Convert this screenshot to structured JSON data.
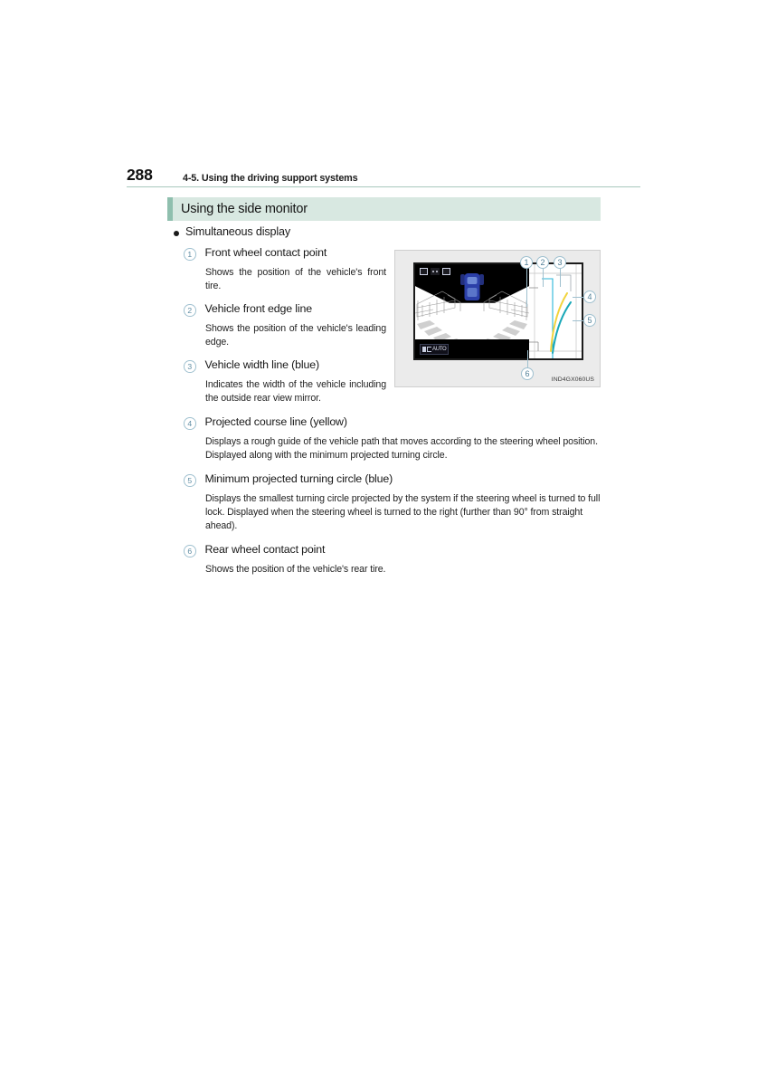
{
  "page": {
    "number": "288",
    "running_head": "4-5. Using the driving support systems"
  },
  "section": {
    "title": "Using the side monitor",
    "accent_color": "#8fbfae",
    "background_color": "#d8e8e1"
  },
  "bullet": {
    "label": "Simultaneous display"
  },
  "items": [
    {
      "num": "1",
      "title": "Front wheel contact point",
      "desc": "Shows the position of the vehicle's front tire.",
      "width": "narrow"
    },
    {
      "num": "2",
      "title": "Vehicle front edge line",
      "desc": "Shows the position of the vehicle's leading edge.",
      "width": "narrow"
    },
    {
      "num": "3",
      "title": "Vehicle width line (blue)",
      "desc": "Indicates the width of the vehicle including the outside rear view mirror.",
      "width": "narrow"
    },
    {
      "num": "4",
      "title": "Projected course line (yellow)",
      "desc": "Displays a rough guide of the vehicle path that moves according to the steering wheel position. Displayed along with the minimum projected turning circle.",
      "width": "wide"
    },
    {
      "num": "5",
      "title": "Minimum projected turning circle (blue)",
      "desc": "Displays the smallest turning circle projected by the system if the steering wheel is turned to full lock. Displayed when the steering wheel is turned to the right (further than 90° from straight ahead).",
      "width": "wide"
    },
    {
      "num": "6",
      "title": "Rear wheel contact point",
      "desc": "Shows the position of the vehicle's rear tire.",
      "width": "wide"
    }
  ],
  "figure": {
    "code": "IND4GX060US",
    "callouts": [
      "1",
      "2",
      "3",
      "4",
      "5",
      "6"
    ],
    "monitor": {
      "auto_label": "AUTO",
      "guide_colors": {
        "vehicle_width_line": "#29b6d8",
        "projected_course_line": "#f2d33c",
        "minimum_turning_circle": "#19a8b8"
      }
    }
  }
}
